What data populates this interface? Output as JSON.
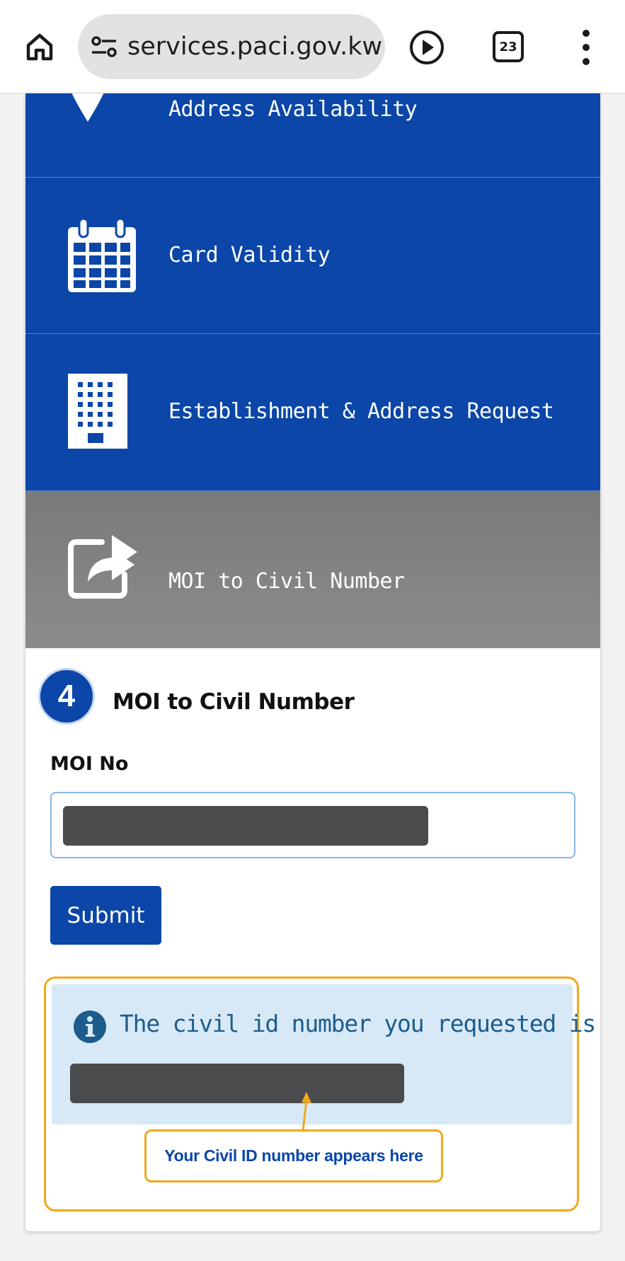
{
  "browser": {
    "url": "services.paci.gov.kw",
    "tab_count": "23",
    "icons": {
      "home": "home-icon",
      "site_settings": "tune-icon",
      "play": "play-icon",
      "tabs": "tab-switcher-icon",
      "menu": "more-vert-icon"
    }
  },
  "menu": {
    "items": [
      {
        "label": "Address Availability",
        "icon": "map-pin-icon"
      },
      {
        "label": "Card Validity",
        "icon": "calendar-icon"
      },
      {
        "label": "Establishment & Address Request",
        "icon": "building-icon"
      },
      {
        "label": "MOI to Civil Number",
        "icon": "share-arrow-icon",
        "active": true
      }
    ],
    "colors": {
      "item_bg": "#0b46a8",
      "active_bg": "#858585",
      "text": "#ffffff"
    }
  },
  "form": {
    "step_number": "4",
    "title": "MOI to Civil Number",
    "field_label": "MOI No",
    "field_value_redacted": true,
    "submit_label": "Submit"
  },
  "result": {
    "message": "The civil id number you requested is",
    "value_redacted": true,
    "callout": "Your Civil ID number appears here",
    "colors": {
      "alert_bg": "#d7e9f7",
      "alert_text": "#1d5c8c",
      "highlight": "#f2a81d"
    }
  }
}
